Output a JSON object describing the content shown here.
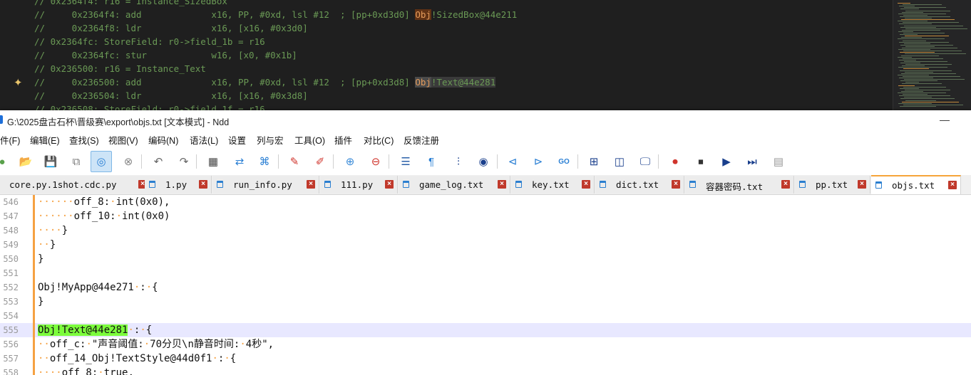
{
  "background_editor": {
    "lines": [
      {
        "pre": "// 0x2364f4: r16 = Instance_SizedBox",
        "obj": "",
        "rest": "",
        "style": ""
      },
      {
        "pre": "//     0x2364f4: add             x16, PP, #0xd, lsl #12  ; [pp+0xd3d0] ",
        "obj": "Obj",
        "rest": "!SizedBox@44e211",
        "style": "a"
      },
      {
        "pre": "//     0x2364f8: ldr             x16, [x16, #0x3d0]",
        "obj": "",
        "rest": "",
        "style": ""
      },
      {
        "pre": "// 0x2364fc: StoreField: r0->field_1b = r16",
        "obj": "",
        "rest": "",
        "style": ""
      },
      {
        "pre": "//     0x2364fc: stur            w16, [x0, #0x1b]",
        "obj": "",
        "rest": "",
        "style": ""
      },
      {
        "pre": "// 0x236500: r16 = Instance_Text",
        "obj": "",
        "rest": "",
        "style": ""
      },
      {
        "pre": "//     0x236500: add             x16, PP, #0xd, lsl #12  ; [pp+0xd3d8] ",
        "obj": "Obj",
        "rest": "!Text@44e281",
        "style": "b"
      },
      {
        "pre": "//     0x236504: ldr             x16, [x16, #0x3d8]",
        "obj": "",
        "rest": "",
        "style": ""
      },
      {
        "pre": "// 0x236508: StoreField: r0->field_1f = r16",
        "obj": "",
        "rest": "",
        "style": ""
      }
    ]
  },
  "window": {
    "title": "G:\\2025盘古石杯\\晋级赛\\export\\objs.txt [文本模式] - Ndd",
    "minimize_glyph": "—"
  },
  "menu": [
    "件(F)",
    "编辑(E)",
    "查找(S)",
    "视图(V)",
    "编码(N)",
    "语法(L)",
    "设置",
    "列与宏",
    "工具(O)",
    "插件",
    "对比(C)",
    "反馈注册"
  ],
  "toolbar_icons": [
    {
      "name": "new-file-icon",
      "glyph": "●",
      "color": "#5aa14c"
    },
    {
      "name": "open-folder-icon",
      "glyph": "📂",
      "color": "#e0a030"
    },
    {
      "name": "save-icon",
      "glyph": "💾",
      "color": "#777"
    },
    {
      "name": "save-all-icon",
      "glyph": "⧉",
      "color": "#777"
    },
    {
      "name": "auto-save-icon",
      "glyph": "◎",
      "color": "#2a7fd4"
    },
    {
      "name": "close-file-icon",
      "glyph": "⊗",
      "color": "#888"
    },
    {
      "name": "undo-icon",
      "glyph": "↶",
      "color": "#666"
    },
    {
      "name": "redo-icon",
      "glyph": "↷",
      "color": "#666"
    },
    {
      "name": "find-icon",
      "glyph": "▦",
      "color": "#444"
    },
    {
      "name": "replace-icon",
      "glyph": "⇄",
      "color": "#2a7fd4"
    },
    {
      "name": "bookmark-icon",
      "glyph": "⌘",
      "color": "#2a7fd4"
    },
    {
      "name": "mark-icon",
      "glyph": "✎",
      "color": "#d0342c"
    },
    {
      "name": "clear-mark-icon",
      "glyph": "✐",
      "color": "#d0342c"
    },
    {
      "name": "zoom-in-icon",
      "glyph": "⊕",
      "color": "#3a8bd8"
    },
    {
      "name": "zoom-out-icon",
      "glyph": "⊖",
      "color": "#d0342c"
    },
    {
      "name": "word-wrap-icon",
      "glyph": "☰",
      "color": "#2a5fa8"
    },
    {
      "name": "show-symbols-icon",
      "glyph": "¶",
      "color": "#2a7fd4"
    },
    {
      "name": "indent-guide-icon",
      "glyph": "⫶",
      "color": "#1a3f8c"
    },
    {
      "name": "record-view-icon",
      "glyph": "◉",
      "color": "#1a3f8c"
    },
    {
      "name": "prev-icon",
      "glyph": "⊲",
      "color": "#2a7fd4"
    },
    {
      "name": "next-icon",
      "glyph": "⊳",
      "color": "#2a7fd4"
    },
    {
      "name": "goto-icon",
      "glyph": "GO",
      "color": "#2a7fd4"
    },
    {
      "name": "column-mode-icon",
      "glyph": "⊞",
      "color": "#1a3f8c"
    },
    {
      "name": "split-view-icon",
      "glyph": "◫",
      "color": "#1a3f8c"
    },
    {
      "name": "monitor-icon",
      "glyph": "🖵",
      "color": "#1a3f8c"
    },
    {
      "name": "macro-record-icon",
      "glyph": "⏺",
      "color": "#d0342c"
    },
    {
      "name": "macro-stop-icon",
      "glyph": "⏹",
      "color": "#333"
    },
    {
      "name": "macro-play-icon",
      "glyph": "▶",
      "color": "#1a3f8c"
    },
    {
      "name": "macro-run-multi-icon",
      "glyph": "⏭",
      "color": "#1a3f8c"
    },
    {
      "name": "macro-save-icon",
      "glyph": "▤",
      "color": "#999"
    }
  ],
  "tabs": [
    {
      "label": "core.py.1shot.cdc.py",
      "active": false
    },
    {
      "label": "1.py",
      "active": false
    },
    {
      "label": "run_info.py",
      "active": false
    },
    {
      "label": "111.py",
      "active": false
    },
    {
      "label": "game_log.txt",
      "active": false
    },
    {
      "label": "key.txt",
      "active": false
    },
    {
      "label": "dict.txt",
      "active": false
    },
    {
      "label": "容器密码.txt",
      "active": false
    },
    {
      "label": "pp.txt",
      "active": false
    },
    {
      "label": "objs.txt",
      "active": true
    }
  ],
  "editor": {
    "lines": [
      {
        "num": "546",
        "indent": 6,
        "text": "off_8:·int(0x0),",
        "match": ""
      },
      {
        "num": "547",
        "indent": 6,
        "text": "off_10:·int(0x0)",
        "match": ""
      },
      {
        "num": "548",
        "indent": 4,
        "text": "}",
        "match": ""
      },
      {
        "num": "549",
        "indent": 2,
        "text": "}",
        "match": ""
      },
      {
        "num": "550",
        "indent": 0,
        "text": "}",
        "match": ""
      },
      {
        "num": "551",
        "indent": 0,
        "text": "",
        "match": ""
      },
      {
        "num": "552",
        "indent": 0,
        "text": "Obj!MyApp@44e271·:·{",
        "match": ""
      },
      {
        "num": "553",
        "indent": 0,
        "text": "}",
        "match": ""
      },
      {
        "num": "554",
        "indent": 0,
        "text": "",
        "match": ""
      },
      {
        "num": "555",
        "indent": 0,
        "text": "·:·{",
        "match": "Obj!Text@44e281",
        "current": true
      },
      {
        "num": "556",
        "indent": 2,
        "text": "off_c:·\"声音阈值:·70分贝\\n静音时间:·4秒\",",
        "match": ""
      },
      {
        "num": "557",
        "indent": 2,
        "text": "off_14_Obj!TextStyle@44d0f1·:·{",
        "match": ""
      },
      {
        "num": "558",
        "indent": 4,
        "text": "off_8:·true,",
        "match": ""
      }
    ]
  }
}
